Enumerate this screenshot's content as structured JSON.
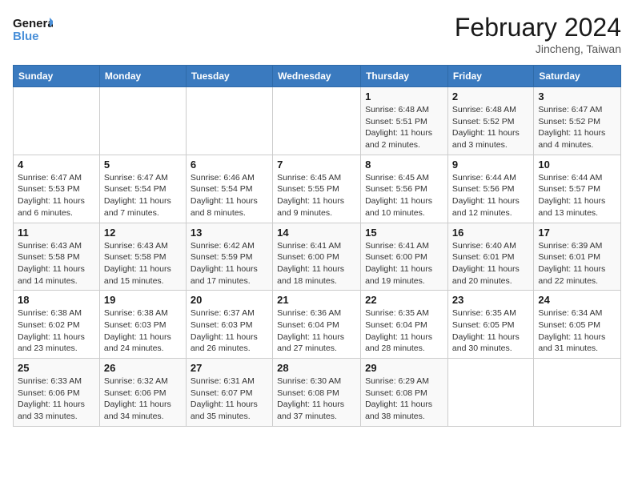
{
  "header": {
    "logo_line1": "General",
    "logo_line2": "Blue",
    "month_title": "February 2024",
    "location": "Jincheng, Taiwan"
  },
  "weekdays": [
    "Sunday",
    "Monday",
    "Tuesday",
    "Wednesday",
    "Thursday",
    "Friday",
    "Saturday"
  ],
  "weeks": [
    [
      {
        "day": "",
        "info": ""
      },
      {
        "day": "",
        "info": ""
      },
      {
        "day": "",
        "info": ""
      },
      {
        "day": "",
        "info": ""
      },
      {
        "day": "1",
        "info": "Sunrise: 6:48 AM\nSunset: 5:51 PM\nDaylight: 11 hours and 2 minutes."
      },
      {
        "day": "2",
        "info": "Sunrise: 6:48 AM\nSunset: 5:52 PM\nDaylight: 11 hours and 3 minutes."
      },
      {
        "day": "3",
        "info": "Sunrise: 6:47 AM\nSunset: 5:52 PM\nDaylight: 11 hours and 4 minutes."
      }
    ],
    [
      {
        "day": "4",
        "info": "Sunrise: 6:47 AM\nSunset: 5:53 PM\nDaylight: 11 hours and 6 minutes."
      },
      {
        "day": "5",
        "info": "Sunrise: 6:47 AM\nSunset: 5:54 PM\nDaylight: 11 hours and 7 minutes."
      },
      {
        "day": "6",
        "info": "Sunrise: 6:46 AM\nSunset: 5:54 PM\nDaylight: 11 hours and 8 minutes."
      },
      {
        "day": "7",
        "info": "Sunrise: 6:45 AM\nSunset: 5:55 PM\nDaylight: 11 hours and 9 minutes."
      },
      {
        "day": "8",
        "info": "Sunrise: 6:45 AM\nSunset: 5:56 PM\nDaylight: 11 hours and 10 minutes."
      },
      {
        "day": "9",
        "info": "Sunrise: 6:44 AM\nSunset: 5:56 PM\nDaylight: 11 hours and 12 minutes."
      },
      {
        "day": "10",
        "info": "Sunrise: 6:44 AM\nSunset: 5:57 PM\nDaylight: 11 hours and 13 minutes."
      }
    ],
    [
      {
        "day": "11",
        "info": "Sunrise: 6:43 AM\nSunset: 5:58 PM\nDaylight: 11 hours and 14 minutes."
      },
      {
        "day": "12",
        "info": "Sunrise: 6:43 AM\nSunset: 5:58 PM\nDaylight: 11 hours and 15 minutes."
      },
      {
        "day": "13",
        "info": "Sunrise: 6:42 AM\nSunset: 5:59 PM\nDaylight: 11 hours and 17 minutes."
      },
      {
        "day": "14",
        "info": "Sunrise: 6:41 AM\nSunset: 6:00 PM\nDaylight: 11 hours and 18 minutes."
      },
      {
        "day": "15",
        "info": "Sunrise: 6:41 AM\nSunset: 6:00 PM\nDaylight: 11 hours and 19 minutes."
      },
      {
        "day": "16",
        "info": "Sunrise: 6:40 AM\nSunset: 6:01 PM\nDaylight: 11 hours and 20 minutes."
      },
      {
        "day": "17",
        "info": "Sunrise: 6:39 AM\nSunset: 6:01 PM\nDaylight: 11 hours and 22 minutes."
      }
    ],
    [
      {
        "day": "18",
        "info": "Sunrise: 6:38 AM\nSunset: 6:02 PM\nDaylight: 11 hours and 23 minutes."
      },
      {
        "day": "19",
        "info": "Sunrise: 6:38 AM\nSunset: 6:03 PM\nDaylight: 11 hours and 24 minutes."
      },
      {
        "day": "20",
        "info": "Sunrise: 6:37 AM\nSunset: 6:03 PM\nDaylight: 11 hours and 26 minutes."
      },
      {
        "day": "21",
        "info": "Sunrise: 6:36 AM\nSunset: 6:04 PM\nDaylight: 11 hours and 27 minutes."
      },
      {
        "day": "22",
        "info": "Sunrise: 6:35 AM\nSunset: 6:04 PM\nDaylight: 11 hours and 28 minutes."
      },
      {
        "day": "23",
        "info": "Sunrise: 6:35 AM\nSunset: 6:05 PM\nDaylight: 11 hours and 30 minutes."
      },
      {
        "day": "24",
        "info": "Sunrise: 6:34 AM\nSunset: 6:05 PM\nDaylight: 11 hours and 31 minutes."
      }
    ],
    [
      {
        "day": "25",
        "info": "Sunrise: 6:33 AM\nSunset: 6:06 PM\nDaylight: 11 hours and 33 minutes."
      },
      {
        "day": "26",
        "info": "Sunrise: 6:32 AM\nSunset: 6:06 PM\nDaylight: 11 hours and 34 minutes."
      },
      {
        "day": "27",
        "info": "Sunrise: 6:31 AM\nSunset: 6:07 PM\nDaylight: 11 hours and 35 minutes."
      },
      {
        "day": "28",
        "info": "Sunrise: 6:30 AM\nSunset: 6:08 PM\nDaylight: 11 hours and 37 minutes."
      },
      {
        "day": "29",
        "info": "Sunrise: 6:29 AM\nSunset: 6:08 PM\nDaylight: 11 hours and 38 minutes."
      },
      {
        "day": "",
        "info": ""
      },
      {
        "day": "",
        "info": ""
      }
    ]
  ]
}
